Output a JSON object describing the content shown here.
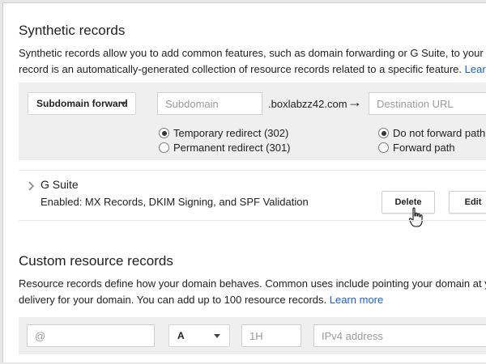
{
  "synthetic": {
    "title": "Synthetic records",
    "desc_line1": "Synthetic records allow you to add common features, such as domain forwarding or G Suite, to your domain",
    "desc_line2": "record is an automatically-generated collection of resource records related to a specific feature.",
    "learn_more": "Learn more",
    "type_select": "Subdomain forward",
    "subdomain_placeholder": "Subdomain",
    "domain_suffix": ".boxlabzz42.com",
    "destination_placeholder": "Destination URL",
    "redirect_options": [
      "Temporary redirect (302)",
      "Permanent redirect (301)"
    ],
    "redirect_selected": "Temporary redirect (302)",
    "path_options": [
      "Do not forward path",
      "Forward path"
    ],
    "path_selected": "Do not forward path"
  },
  "gsuite": {
    "name": "G Suite",
    "status": "Enabled: MX Records, DKIM Signing, and SPF Validation",
    "delete_label": "Delete",
    "edit_label": "Edit"
  },
  "custom": {
    "title": "Custom resource records",
    "desc_line1": "Resource records define how your domain behaves. Common uses include pointing your domain at your we",
    "desc_line2": "delivery for your domain. You can add up to 100 resource records.",
    "learn_more": "Learn more",
    "name_placeholder": "@",
    "type_select": "A",
    "ttl_placeholder": "1H",
    "data_placeholder": "IPv4 address"
  },
  "icons": {
    "arrow": "→",
    "chevron": "chevron-right-icon",
    "caret": "caret-down-icon",
    "cursor": "hand-pointer-icon"
  },
  "colors": {
    "link": "#1a5fcf",
    "panel": "#efefef"
  }
}
